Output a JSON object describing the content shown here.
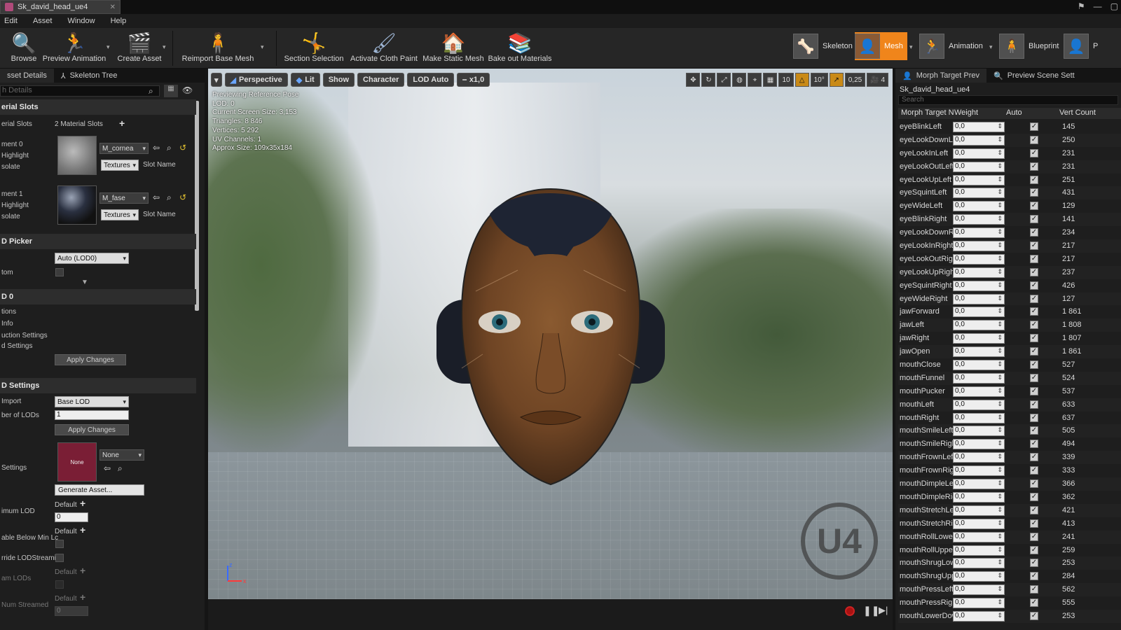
{
  "window": {
    "tab_title": "Sk_david_head_ue4",
    "tab_close": "✕",
    "controls": [
      "⚑",
      "—",
      "▢"
    ]
  },
  "menu": [
    "Edit",
    "Asset",
    "Window",
    "Help"
  ],
  "toolbar": {
    "buttons": [
      "Browse",
      "Preview Animation",
      "Create Asset",
      "Reimport Base Mesh",
      "Section Selection",
      "Activate Cloth Paint",
      "Make Static Mesh",
      "Bake out Materials"
    ],
    "modes": [
      "Skeleton",
      "Mesh",
      "Animation",
      "Blueprint",
      "P"
    ],
    "active_mode": "Mesh",
    "accent_color": "#f0851b"
  },
  "left_panel": {
    "tabs": [
      "sset Details",
      "Skeleton Tree"
    ],
    "search_placeholder": "h Details",
    "material_slots": {
      "header": "erial Slots",
      "label": "erial Slots",
      "count": "2 Material Slots",
      "element0": {
        "label": "ment 0",
        "highlight": "Highlight",
        "isolate": "solate",
        "material": "M_cornea",
        "textures": "Textures",
        "slot_name": "Slot Name"
      },
      "element1": {
        "label": "ment 1",
        "highlight": "Highlight",
        "isolate": "solate",
        "material": "M_fase",
        "textures": "Textures",
        "slot_name": "Slot Name"
      }
    },
    "lod_picker": {
      "header": "D Picker",
      "row1": "",
      "lod_value": "Auto (LOD0)",
      "custom": "tom"
    },
    "lod0": {
      "header": "D 0",
      "items": [
        "tions",
        "Info",
        "uction Settings",
        "d Settings"
      ],
      "apply": "Apply Changes"
    },
    "lod_settings": {
      "header": "D Settings",
      "import_label": "Import",
      "import_value": "Base LOD",
      "num_lods_label": "ber of LODs",
      "num_lods_value": "1",
      "apply": "Apply Changes",
      "settings_label": "Settings",
      "thumb_text": "None",
      "none_value": "None",
      "generate": "Generate Asset...",
      "min_lod_label": "imum LOD",
      "default1": "Default",
      "min_lod_value": "0",
      "below_min_label": "able Below Min Lc",
      "default2": "Default",
      "override_label": "rride LODStreami",
      "stream_lods_label": "am LODs",
      "default3": "Default",
      "num_streamed_label": "Num Streamed",
      "default4": "Default",
      "num_streamed_value": "0"
    }
  },
  "viewport": {
    "toolbar": [
      "Perspective",
      "Lit",
      "Show",
      "Character",
      "LOD Auto",
      "x1,0"
    ],
    "right_controls": [
      "10",
      "10°",
      "0,25",
      "4"
    ],
    "stats": [
      "Previewing Reference Pose",
      "LOD: 0",
      "Current Screen Size: 3,153",
      "Triangles: 8 846",
      "Vertices: 5 292",
      "UV Channels: 1",
      "Approx Size: 109x35x184"
    ],
    "axis_z": "z",
    "axis_x": "x",
    "logo": "U4"
  },
  "right_panel": {
    "tabs": [
      "Morph Target Prev",
      "Preview Scene Sett"
    ],
    "asset": "Sk_david_head_ue4",
    "search_placeholder": "Search",
    "columns": [
      "Morph Target N",
      "Weight",
      "Auto",
      "Vert Count"
    ],
    "rows": [
      {
        "name": "eyeBlinkLeft",
        "weight": "0,0",
        "auto": true,
        "verts": "145"
      },
      {
        "name": "eyeLookDownLeft",
        "weight": "0,0",
        "auto": true,
        "verts": "250"
      },
      {
        "name": "eyeLookInLeft",
        "weight": "0,0",
        "auto": true,
        "verts": "231"
      },
      {
        "name": "eyeLookOutLeft",
        "weight": "0,0",
        "auto": true,
        "verts": "231"
      },
      {
        "name": "eyeLookUpLeft",
        "weight": "0,0",
        "auto": true,
        "verts": "251"
      },
      {
        "name": "eyeSquintLeft",
        "weight": "0,0",
        "auto": true,
        "verts": "431"
      },
      {
        "name": "eyeWideLeft",
        "weight": "0,0",
        "auto": true,
        "verts": "129"
      },
      {
        "name": "eyeBlinkRight",
        "weight": "0,0",
        "auto": true,
        "verts": "141"
      },
      {
        "name": "eyeLookDownRight",
        "weight": "0,0",
        "auto": true,
        "verts": "234"
      },
      {
        "name": "eyeLookInRight",
        "weight": "0,0",
        "auto": true,
        "verts": "217"
      },
      {
        "name": "eyeLookOutRight",
        "weight": "0,0",
        "auto": true,
        "verts": "217"
      },
      {
        "name": "eyeLookUpRight",
        "weight": "0,0",
        "auto": true,
        "verts": "237"
      },
      {
        "name": "eyeSquintRight",
        "weight": "0,0",
        "auto": true,
        "verts": "426"
      },
      {
        "name": "eyeWideRight",
        "weight": "0,0",
        "auto": true,
        "verts": "127"
      },
      {
        "name": "jawForward",
        "weight": "0,0",
        "auto": true,
        "verts": "1 861"
      },
      {
        "name": "jawLeft",
        "weight": "0,0",
        "auto": true,
        "verts": "1 808"
      },
      {
        "name": "jawRight",
        "weight": "0,0",
        "auto": true,
        "verts": "1 807"
      },
      {
        "name": "jawOpen",
        "weight": "0,0",
        "auto": true,
        "verts": "1 861"
      },
      {
        "name": "mouthClose",
        "weight": "0,0",
        "auto": true,
        "verts": "527"
      },
      {
        "name": "mouthFunnel",
        "weight": "0,0",
        "auto": true,
        "verts": "524"
      },
      {
        "name": "mouthPucker",
        "weight": "0,0",
        "auto": true,
        "verts": "537"
      },
      {
        "name": "mouthLeft",
        "weight": "0,0",
        "auto": true,
        "verts": "633"
      },
      {
        "name": "mouthRight",
        "weight": "0,0",
        "auto": true,
        "verts": "637"
      },
      {
        "name": "mouthSmileLeft",
        "weight": "0,0",
        "auto": true,
        "verts": "505"
      },
      {
        "name": "mouthSmileRight",
        "weight": "0,0",
        "auto": true,
        "verts": "494"
      },
      {
        "name": "mouthFrownLeft",
        "weight": "0,0",
        "auto": true,
        "verts": "339"
      },
      {
        "name": "mouthFrownRight",
        "weight": "0,0",
        "auto": true,
        "verts": "333"
      },
      {
        "name": "mouthDimpleLeft",
        "weight": "0,0",
        "auto": true,
        "verts": "366"
      },
      {
        "name": "mouthDimpleRight",
        "weight": "0,0",
        "auto": true,
        "verts": "362"
      },
      {
        "name": "mouthStretchLeft",
        "weight": "0,0",
        "auto": true,
        "verts": "421"
      },
      {
        "name": "mouthStretchRight",
        "weight": "0,0",
        "auto": true,
        "verts": "413"
      },
      {
        "name": "mouthRollLower",
        "weight": "0,0",
        "auto": true,
        "verts": "241"
      },
      {
        "name": "mouthRollUpper",
        "weight": "0,0",
        "auto": true,
        "verts": "259"
      },
      {
        "name": "mouthShrugLower",
        "weight": "0,0",
        "auto": true,
        "verts": "253"
      },
      {
        "name": "mouthShrugUpper",
        "weight": "0,0",
        "auto": true,
        "verts": "284"
      },
      {
        "name": "mouthPressLeft",
        "weight": "0,0",
        "auto": true,
        "verts": "562"
      },
      {
        "name": "mouthPressRight",
        "weight": "0,0",
        "auto": true,
        "verts": "555"
      },
      {
        "name": "mouthLowerDownLeft",
        "weight": "0,0",
        "auto": true,
        "verts": "253"
      }
    ]
  }
}
